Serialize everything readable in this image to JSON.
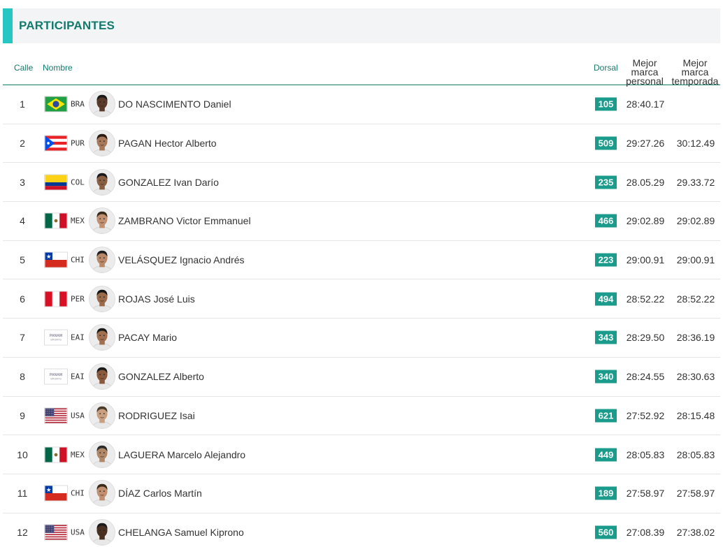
{
  "section": {
    "title": "PARTICIPANTES"
  },
  "columns": {
    "lane": "Calle",
    "name": "Nombre",
    "bib": "Dorsal",
    "personal_best": "Mejor marca personal",
    "season_best": "Mejor marca temporada"
  },
  "colors": {
    "accent": "#26c6c2",
    "primary": "#137a6c",
    "bib_bg": "#1a9b8c"
  },
  "athletes": [
    {
      "lane": "1",
      "country": "BRA",
      "flag": "BRA",
      "name": "DO NASCIMENTO Daniel",
      "bib": "105",
      "pb": "28:40.17",
      "sb": "",
      "skin": "#5a3a28",
      "hair": "#1a1a1a"
    },
    {
      "lane": "2",
      "country": "PUR",
      "flag": "PUR",
      "name": "PAGAN Hector Alberto",
      "bib": "509",
      "pb": "29:27.26",
      "sb": "30:12.49",
      "skin": "#a8795a",
      "hair": "#2a1c12"
    },
    {
      "lane": "3",
      "country": "COL",
      "flag": "COL",
      "name": "GONZALEZ Ivan Darío",
      "bib": "235",
      "pb": "28.05.29",
      "sb": "29.33.72",
      "skin": "#8a5e42",
      "hair": "#1a1a1a"
    },
    {
      "lane": "4",
      "country": "MEX",
      "flag": "MEX",
      "name": "ZAMBRANO Victor Emmanuel",
      "bib": "466",
      "pb": "29:02.89",
      "sb": "29:02.89",
      "skin": "#c09070",
      "hair": "#3a2a1a"
    },
    {
      "lane": "5",
      "country": "CHI",
      "flag": "CHI",
      "name": "VELÁSQUEZ Ignacio Andrés",
      "bib": "223",
      "pb": "29:00.91",
      "sb": "29:00.91",
      "skin": "#b88868",
      "hair": "#1e1e1e"
    },
    {
      "lane": "6",
      "country": "PER",
      "flag": "PER",
      "name": "ROJAS José Luis",
      "bib": "494",
      "pb": "28:52.22",
      "sb": "28:52.22",
      "skin": "#9a6a4a",
      "hair": "#141414"
    },
    {
      "lane": "7",
      "country": "EAI",
      "flag": "EAI",
      "name": "PACAY Mario",
      "bib": "343",
      "pb": "28:29.50",
      "sb": "28:36.19",
      "skin": "#a07050",
      "hair": "#1a1a1a"
    },
    {
      "lane": "8",
      "country": "EAI",
      "flag": "EAI",
      "name": "GONZALEZ Alberto",
      "bib": "340",
      "pb": "28:24.55",
      "sb": "28:30.63",
      "skin": "#8a5a3e",
      "hair": "#1a1a1a"
    },
    {
      "lane": "9",
      "country": "USA",
      "flag": "USA",
      "name": "RODRIGUEZ Isai",
      "bib": "621",
      "pb": "27:52.92",
      "sb": "28:15.48",
      "skin": "#c8a080",
      "hair": "#4a3a2a"
    },
    {
      "lane": "10",
      "country": "MEX",
      "flag": "MEX",
      "name": "LAGUERA Marcelo Alejandro",
      "bib": "449",
      "pb": "28:05.83",
      "sb": "28:05.83",
      "skin": "#b08868",
      "hair": "#2a2a2a"
    },
    {
      "lane": "11",
      "country": "CHI",
      "flag": "CHI",
      "name": "DÍAZ Carlos Martín",
      "bib": "189",
      "pb": "27:58.97",
      "sb": "27:58.97",
      "skin": "#c09070",
      "hair": "#3a2a1a"
    },
    {
      "lane": "12",
      "country": "USA",
      "flag": "USA",
      "name": "CHELANGA Samuel Kiprono",
      "bib": "560",
      "pb": "27:08.39",
      "sb": "27:38.02",
      "skin": "#4a3020",
      "hair": "#1a1a1a"
    }
  ],
  "eai_logo_text": "PANAM SPORTS"
}
